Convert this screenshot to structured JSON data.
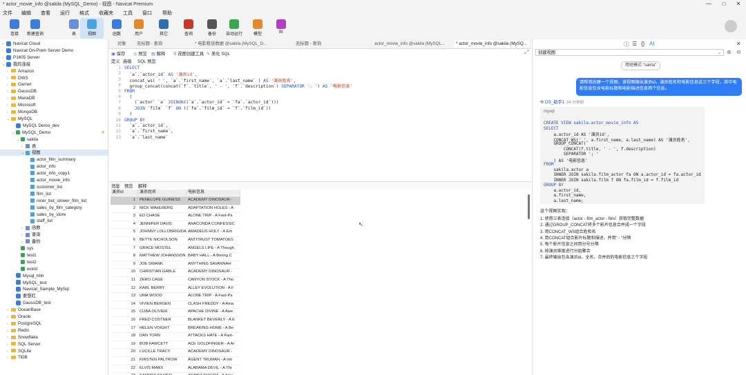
{
  "window": {
    "title": "* actor_movie_info @sakila (MySQL_Demo) - 视图 - Navicat Premium",
    "controls": [
      "—",
      "□",
      "✕"
    ]
  },
  "menu": [
    "文件",
    "编辑",
    "查看",
    "运行",
    "格式",
    "收藏夹",
    "工具",
    "窗口",
    "帮助"
  ],
  "toolbar": [
    {
      "label": "连接",
      "color": "#3b7dd8"
    },
    {
      "label": "新建查询",
      "color": "#3b7dd8"
    },
    {
      "label": "表",
      "color": "#6b8fd6"
    },
    {
      "label": "视图",
      "color": "#4aa3df"
    },
    {
      "label": "函数",
      "color": "#3b7dd8"
    },
    {
      "label": "用户",
      "color": "#e08a2c"
    },
    {
      "label": "其它",
      "color": "#2f6fb0"
    },
    {
      "label": "查询",
      "color": "#c0392b"
    },
    {
      "label": "备份",
      "color": "#555555"
    },
    {
      "label": "自动运行",
      "color": "#3aa655"
    },
    {
      "label": "模型",
      "color": "#e08a2c"
    },
    {
      "label": "BI",
      "color": "#b040c0"
    }
  ],
  "tree": [
    {
      "label": "Navicat Cloud",
      "level": 0,
      "icon": "conn",
      "arrow": "›"
    },
    {
      "label": "Navicat On-Prem Server Demo",
      "level": 0,
      "icon": "conn",
      "arrow": "›"
    },
    {
      "label": "P1605 Server",
      "level": 0,
      "icon": "conn",
      "arrow": "›"
    },
    {
      "label": "我的连接",
      "level": 0,
      "icon": "conn",
      "arrow": "⌄"
    },
    {
      "label": "Amazon",
      "level": 1,
      "icon": "fold",
      "arrow": "›"
    },
    {
      "label": "DWS",
      "level": 1,
      "icon": "fold",
      "arrow": "›"
    },
    {
      "label": "Garnet",
      "level": 1,
      "icon": "fold",
      "arrow": "›"
    },
    {
      "label": "GaussDB",
      "level": 1,
      "icon": "fold",
      "arrow": "›"
    },
    {
      "label": "MariaDB",
      "level": 1,
      "icon": "fold",
      "arrow": "›"
    },
    {
      "label": "Microsoft",
      "level": 1,
      "icon": "fold",
      "arrow": "›"
    },
    {
      "label": "MongoDB",
      "level": 1,
      "icon": "fold",
      "arrow": "›"
    },
    {
      "label": "MySQL",
      "level": 1,
      "icon": "fold",
      "arrow": "⌄"
    },
    {
      "label": "MySQL Demo_dev",
      "level": 2,
      "icon": "conn",
      "arrow": ""
    },
    {
      "label": "MySQL_Demo",
      "level": 2,
      "icon": "db",
      "arrow": "⌄"
    },
    {
      "label": "sakila",
      "level": 3,
      "icon": "db",
      "arrow": "⌄"
    },
    {
      "label": "表",
      "level": 4,
      "icon": "tbl",
      "arrow": "›"
    },
    {
      "label": "视图",
      "level": 4,
      "icon": "vw",
      "arrow": "⌄",
      "selected": true
    },
    {
      "label": "actor_film_summary",
      "level": 5,
      "icon": "vw",
      "arrow": ""
    },
    {
      "label": "actor_info",
      "level": 5,
      "icon": "vw",
      "arrow": ""
    },
    {
      "label": "actor_info_copy1",
      "level": 5,
      "icon": "vw",
      "arrow": ""
    },
    {
      "label": "actor_movie_info",
      "level": 5,
      "icon": "vw",
      "arrow": ""
    },
    {
      "label": "customer_list",
      "level": 5,
      "icon": "vw",
      "arrow": ""
    },
    {
      "label": "film_list",
      "level": 5,
      "icon": "vw",
      "arrow": ""
    },
    {
      "label": "nicer_but_slower_film_list",
      "level": 5,
      "icon": "vw",
      "arrow": ""
    },
    {
      "label": "sales_by_film_category",
      "level": 5,
      "icon": "vw",
      "arrow": ""
    },
    {
      "label": "sales_by_store",
      "level": 5,
      "icon": "vw",
      "arrow": ""
    },
    {
      "label": "staff_list",
      "level": 5,
      "icon": "vw",
      "arrow": ""
    },
    {
      "label": "函数",
      "level": 4,
      "icon": "tbl",
      "arrow": "›"
    },
    {
      "label": "查询",
      "level": 4,
      "icon": "tbl",
      "arrow": "›"
    },
    {
      "label": "备份",
      "level": 4,
      "icon": "tbl",
      "arrow": "›"
    },
    {
      "label": "sys",
      "level": 3,
      "icon": "db",
      "arrow": ""
    },
    {
      "label": "test1",
      "level": 3,
      "icon": "db",
      "arrow": ""
    },
    {
      "label": "test2",
      "level": 3,
      "icon": "db",
      "arrow": ""
    },
    {
      "label": "world",
      "level": 3,
      "icon": "db",
      "arrow": ""
    },
    {
      "label": "Mysql_hhh",
      "level": 2,
      "icon": "conn",
      "arrow": ""
    },
    {
      "label": "MySQL_test",
      "level": 2,
      "icon": "conn",
      "arrow": ""
    },
    {
      "label": "Navicat_Sample_MySql",
      "level": 2,
      "icon": "conn",
      "arrow": ""
    },
    {
      "label": "要想红",
      "level": 2,
      "icon": "conn",
      "arrow": ""
    },
    {
      "label": "GaussDB_test",
      "level": 2,
      "icon": "conn",
      "arrow": ""
    },
    {
      "label": "OceanBase",
      "level": 1,
      "icon": "fold",
      "arrow": "›"
    },
    {
      "label": "Oracle",
      "level": 1,
      "icon": "fold",
      "arrow": "›"
    },
    {
      "label": "PostgreSQL",
      "level": 1,
      "icon": "fold",
      "arrow": "›"
    },
    {
      "label": "Redis",
      "level": 1,
      "icon": "fold",
      "arrow": "›"
    },
    {
      "label": "Snowflake",
      "level": 1,
      "icon": "fold",
      "arrow": "›"
    },
    {
      "label": "SQL Server",
      "level": 1,
      "icon": "fold",
      "arrow": "›"
    },
    {
      "label": "SQLite",
      "level": 1,
      "icon": "fold",
      "arrow": "›"
    },
    {
      "label": "TiDB",
      "level": 1,
      "icon": "fold",
      "arrow": "›"
    }
  ],
  "tabs": [
    "对象",
    "无标题 - 查询",
    "* 电影租赁数据 @sakila (MySQL_D...",
    "无标题 - 查询",
    "actor_movie_info @sakila (MySQL...",
    "* actor_movie_info @sakila (MySQ..."
  ],
  "editor_toolbar": [
    "保存",
    "预览",
    "解释",
    "视图创建工具",
    "美化 SQL"
  ],
  "subtabs": [
    "定义",
    "高级",
    "SQL 预览"
  ],
  "code_lines": [
    [
      [
        "kw",
        "SELECT"
      ]
    ],
    [
      [
        "",
        "  `a`.`actor_id` "
      ],
      [
        "kw",
        "AS"
      ],
      [
        "str",
        " '演员id'"
      ],
      [
        "",
        ","
      ]
    ],
    [
      [
        "",
        "  concat_ws( ' ', `a`.`first_name`, `a`.`last_name` ) "
      ],
      [
        "kw",
        "AS"
      ],
      [
        "str",
        " '演员姓名'"
      ],
      [
        "",
        ","
      ]
    ],
    [
      [
        "",
        "  group_concat(concat(`f`.`title`, ' - ', `f`.`description`) "
      ],
      [
        "kw",
        "SEPARATOR"
      ],
      [
        "str",
        " '; '"
      ],
      [
        "",
        ") "
      ],
      [
        "kw",
        "AS"
      ],
      [
        "str",
        " '电影信息'"
      ]
    ],
    [
      [
        "kw",
        "FROM"
      ]
    ],
    [
      [
        "",
        "  ("
      ]
    ],
    [
      [
        "",
        "    (`actor` `a` "
      ],
      [
        "kw",
        "JOIN"
      ],
      [
        "",
        "",
        " `film_actor` `fa` "
      ],
      [
        "kw",
        "ON"
      ],
      [
        "",
        "((`a`.`actor_id` = `fa`.`actor_id`)))"
      ]
    ],
    [
      [
        "",
        "    "
      ],
      [
        "kw",
        "JOIN"
      ],
      [
        "",
        " `film` `f` "
      ],
      [
        "kw",
        "ON"
      ],
      [
        "",
        " ((`fa`.`film_id` = `f`.`film_id`))"
      ]
    ],
    [
      [
        "",
        "  )"
      ]
    ],
    [
      [
        "kw",
        "GROUP BY"
      ]
    ],
    [
      [
        "",
        "  `a`.`actor_id`,"
      ]
    ],
    [
      [
        "",
        "  `a`.`first_name`,"
      ]
    ],
    [
      [
        "",
        "  `a`.`last_name`"
      ]
    ]
  ],
  "result_tabs": [
    "消息",
    "预览",
    "解释"
  ],
  "grid": {
    "columns": [
      "演员id",
      "演员姓名",
      "电影信息"
    ],
    "rows": [
      [
        "1",
        "PENELOPE GUINESS",
        "ACADEMY DINOSAUR - "
      ],
      [
        "2",
        "NICK WAHLBERG",
        "ADAPTATION HOLES - A"
      ],
      [
        "3",
        "ED CHASE",
        "ALONE TRIP - A Fast-Pa"
      ],
      [
        "4",
        "JENNIFER DAVIS",
        "ANACONDA CONFESSIC"
      ],
      [
        "5",
        "JOHNNY LOLLOBRIGIDA",
        "AMADEUS HOLY - A Em"
      ],
      [
        "6",
        "BETTE NICHOLSON",
        "ANTITRUST TOMATOES"
      ],
      [
        "7",
        "GRACE MOSTEL",
        "ANGELS LIFE - A Though"
      ],
      [
        "8",
        "MATTHEW JOHANSSON",
        "BABY HALL - A Boring C"
      ],
      [
        "9",
        "JOE SWANK",
        "ANYTHING SAVANNAH"
      ],
      [
        "10",
        "CHRISTIAN GABLE",
        "ACADEMY DINOSAUR - "
      ],
      [
        "11",
        "ZERO CAGE",
        "CANYON STOCK - A Tho"
      ],
      [
        "12",
        "KARL BERRY",
        "ALLEY EVOLUTION - A F"
      ],
      [
        "13",
        "UMA WOOD",
        "ALONE TRIP - A Fast-Pa"
      ],
      [
        "14",
        "VIVIEN BERGEN",
        "CLASH FREDDY - A Ama"
      ],
      [
        "15",
        "CUBA OLIVIER",
        "APACHE DIVINE - A Awe"
      ],
      [
        "16",
        "FRED COSTNER",
        "BLANKET BEVERLY - A E"
      ],
      [
        "17",
        "HELEN VOIGHT",
        "BREAKING HOME - A Be"
      ],
      [
        "18",
        "DAN TORN",
        "ATTACKS HATE - A Fast-"
      ],
      [
        "19",
        "BOB FAWCETT",
        "ACE GOLDFINGER - A Ar"
      ],
      [
        "20",
        "LUCILLE TRACY",
        "ACADEMY DINOSAUR - "
      ],
      [
        "21",
        "KIRSTEN PALTROW",
        "AGENT TRUMAN - A Inti"
      ],
      [
        "22",
        "ELVIS MARX",
        "ALABAMA DEVIL - A Thr"
      ],
      [
        "23",
        "SANDRA KILMER",
        "ARABIA DOGMA - A Ama"
      ]
    ]
  },
  "right": {
    "model": "创建视图",
    "chip": "简短模式 \"sakila\"",
    "user_message": "请帮我创建一个视图，该视图输出演员id，演员姓名和电影信息这三个字段，其中电影信息包含电影标题和电影描述信息两个信息。",
    "ai_name": "DS_助手1",
    "ai_time": "34 分钟前",
    "sql_lang": "mysql",
    "sql_lines": [
      "CREATE VIEW sakila.actor_movie_info AS",
      "SELECT",
      "    a.actor_id AS '演员id',",
      "    CONCAT_WS(' ', a.first_name, a.last_name) AS '演员姓名',",
      "    GROUP_CONCAT(",
      "        CONCAT(f.title, ' - ', f.description)",
      "        SEPARATOR '; '",
      "    ) AS '电影信息'",
      "FROM",
      "    sakila.actor a",
      "    INNER JOIN sakila.film_actor fa ON a.actor_id = fa.actor_id",
      "    INNER JOIN sakila.film f ON fa.film_id = f.film_id",
      "GROUP BY",
      "    a.actor_id,",
      "    a.first_name,",
      "    a.last_name;"
    ],
    "explain_title": "这个视图实现：",
    "explain_items": [
      "1. 使用三表连接（actor - film_actor - film）获取完整数据",
      "2. 通过GROUP_CONCAT将多个影片信息合并成一个字段",
      "3. 用CONCAT_WS组合姓和名",
      "4. 用CONCAT组合影片标题和描述，并用\" - \"分隔",
      "5. 每个影片信息之间用分号分隔",
      "6. 按演员维度进行分组聚合",
      "7. 最终输出包含演员id，全名，合并后的电影信息三个字段"
    ]
  }
}
